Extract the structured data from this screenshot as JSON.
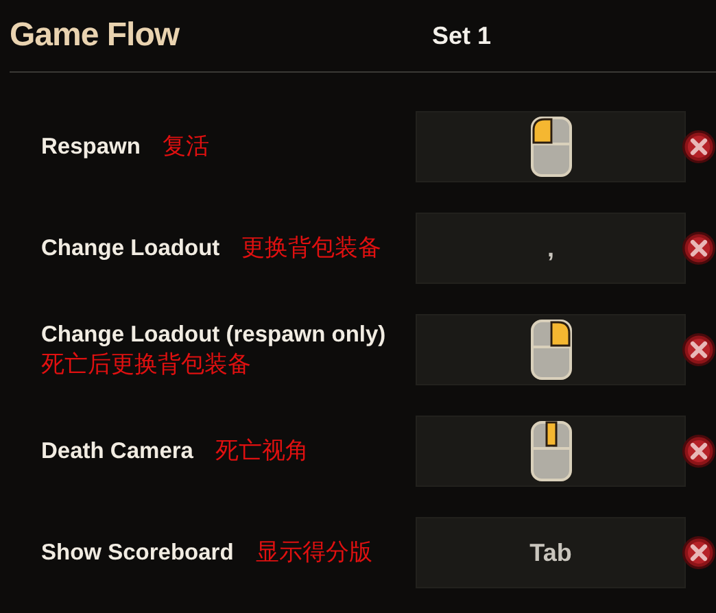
{
  "section": {
    "title": "Game Flow",
    "column_heading": "Set 1"
  },
  "bindings": [
    {
      "action": "Respawn",
      "note": "复活",
      "binding": {
        "kind": "leftclick"
      }
    },
    {
      "action": "Change Loadout",
      "note": "更换背包装备",
      "binding": {
        "kind": "key",
        "label": ","
      }
    },
    {
      "action": "Change Loadout (respawn only)",
      "note": "死亡后更换背包装备",
      "binding": {
        "kind": "rightclick"
      }
    },
    {
      "action": "Death Camera",
      "note": "死亡视角",
      "binding": {
        "kind": "middleclick"
      }
    },
    {
      "action": "Show Scoreboard",
      "note": "显示得分版",
      "binding": {
        "kind": "key",
        "label": "Tab"
      }
    }
  ]
}
